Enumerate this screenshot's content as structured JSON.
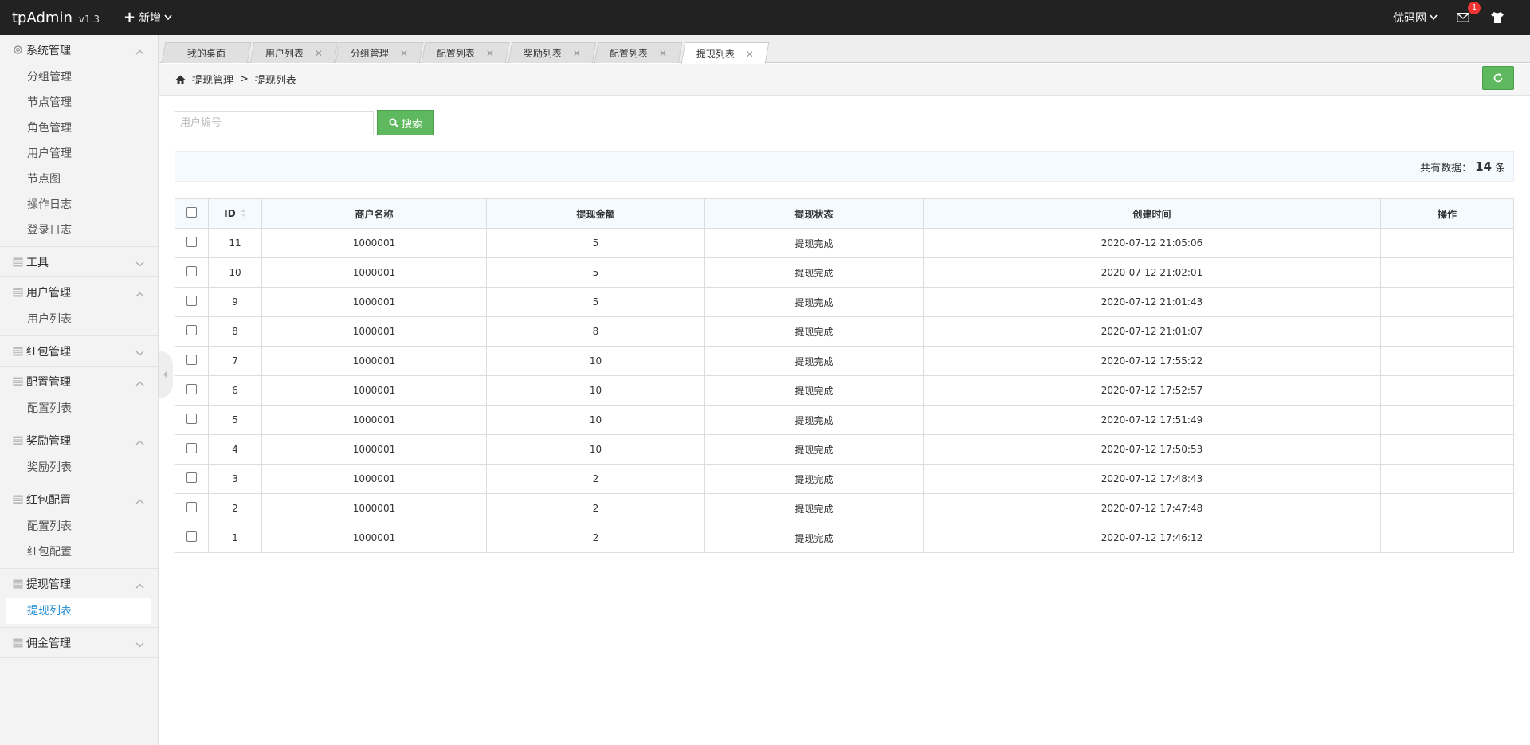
{
  "header": {
    "brand": "tpAdmin",
    "version": "v1.3",
    "new_label": "新增",
    "user_label": "优码网",
    "message_count": "1"
  },
  "sidebar": {
    "groups": [
      {
        "label": "系统管理",
        "items": [
          "分组管理",
          "节点管理",
          "角色管理",
          "用户管理",
          "节点图",
          "操作日志",
          "登录日志"
        ]
      },
      {
        "label": "工具",
        "items": []
      },
      {
        "label": "用户管理",
        "items": [
          "用户列表"
        ]
      },
      {
        "label": "红包管理",
        "items": []
      },
      {
        "label": "配置管理",
        "items": [
          "配置列表"
        ]
      },
      {
        "label": "奖励管理",
        "items": [
          "奖励列表"
        ]
      },
      {
        "label": "红包配置",
        "items": [
          "配置列表",
          "红包配置"
        ]
      },
      {
        "label": "提现管理",
        "items": [
          "提现列表"
        ]
      },
      {
        "label": "佣金管理",
        "items": []
      }
    ]
  },
  "tabs": [
    "我的桌面",
    "用户列表",
    "分组管理",
    "配置列表",
    "奖励列表",
    "配置列表",
    "提现列表"
  ],
  "breadcrumb": {
    "parent": "提现管理",
    "sep": ">",
    "current": "提现列表"
  },
  "search": {
    "placeholder": "用户编号",
    "button_label": "搜索"
  },
  "count": {
    "prefix": "共有数据：",
    "value": "14",
    "suffix": "条"
  },
  "table": {
    "columns": [
      "ID",
      "商户名称",
      "提现金额",
      "提现状态",
      "创建时间",
      "操作"
    ],
    "rows": [
      {
        "id": "11",
        "merchant": "1000001",
        "amount": "5",
        "status": "提现完成",
        "created": "2020-07-12 21:05:06"
      },
      {
        "id": "10",
        "merchant": "1000001",
        "amount": "5",
        "status": "提现完成",
        "created": "2020-07-12 21:02:01"
      },
      {
        "id": "9",
        "merchant": "1000001",
        "amount": "5",
        "status": "提现完成",
        "created": "2020-07-12 21:01:43"
      },
      {
        "id": "8",
        "merchant": "1000001",
        "amount": "8",
        "status": "提现完成",
        "created": "2020-07-12 21:01:07"
      },
      {
        "id": "7",
        "merchant": "1000001",
        "amount": "10",
        "status": "提现完成",
        "created": "2020-07-12 17:55:22"
      },
      {
        "id": "6",
        "merchant": "1000001",
        "amount": "10",
        "status": "提现完成",
        "created": "2020-07-12 17:52:57"
      },
      {
        "id": "5",
        "merchant": "1000001",
        "amount": "10",
        "status": "提现完成",
        "created": "2020-07-12 17:51:49"
      },
      {
        "id": "4",
        "merchant": "1000001",
        "amount": "10",
        "status": "提现完成",
        "created": "2020-07-12 17:50:53"
      },
      {
        "id": "3",
        "merchant": "1000001",
        "amount": "2",
        "status": "提现完成",
        "created": "2020-07-12 17:48:43"
      },
      {
        "id": "2",
        "merchant": "1000001",
        "amount": "2",
        "status": "提现完成",
        "created": "2020-07-12 17:47:48"
      },
      {
        "id": "1",
        "merchant": "1000001",
        "amount": "2",
        "status": "提现完成",
        "created": "2020-07-12 17:46:12"
      }
    ]
  },
  "colors": {
    "header_bg": "#222222",
    "accent_green": "#5eb95e",
    "status_red": "#ee3333",
    "active_link": "#1e8bd3"
  }
}
